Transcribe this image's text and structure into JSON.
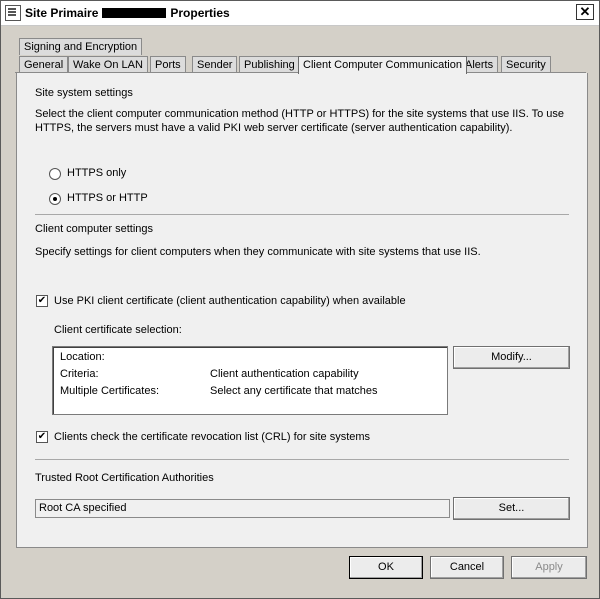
{
  "window": {
    "title_prefix": "Site Primaire",
    "title_suffix": "Properties",
    "close_symbol": "✕"
  },
  "tabs_row1": [
    {
      "label": "Signing and Encryption"
    }
  ],
  "tabs_row2": [
    {
      "label": "General"
    },
    {
      "label": "Wake On LAN"
    },
    {
      "label": "Ports"
    },
    {
      "label": "Sender"
    },
    {
      "label": "Publishing"
    },
    {
      "label": "Client Computer Communication",
      "active": true
    },
    {
      "label": "Alerts"
    },
    {
      "label": "Security"
    }
  ],
  "site_settings": {
    "header": "Site system settings",
    "description": "Select the client computer communication method (HTTP or HTTPS) for the site systems that use IIS. To use HTTPS, the servers must have a valid PKI web server certificate (server authentication capability).",
    "options": [
      {
        "label": "HTTPS only",
        "selected": false
      },
      {
        "label": "HTTPS or HTTP",
        "selected": true
      }
    ]
  },
  "client_settings": {
    "header": "Client computer settings",
    "description": "Specify settings for client computers when they communicate with site systems that use IIS.",
    "use_pki_label": "Use PKI client certificate (client authentication capability) when available",
    "use_pki_checked": true,
    "selection_label": "Client certificate selection:",
    "rows": [
      {
        "key": "Location:",
        "value": ""
      },
      {
        "key": "Criteria:",
        "value": "Client authentication capability"
      },
      {
        "key": "Multiple Certificates:",
        "value": "Select any certificate that matches"
      }
    ],
    "modify_button": "Modify...",
    "crl_label": "Clients check the certificate revocation list (CRL) for site systems",
    "crl_checked": true
  },
  "trusted_root": {
    "header": "Trusted Root Certification Authorities",
    "value": "Root CA specified",
    "set_button": "Set..."
  },
  "footer": {
    "ok": "OK",
    "cancel": "Cancel",
    "apply": "Apply"
  },
  "check_symbol": "✔"
}
